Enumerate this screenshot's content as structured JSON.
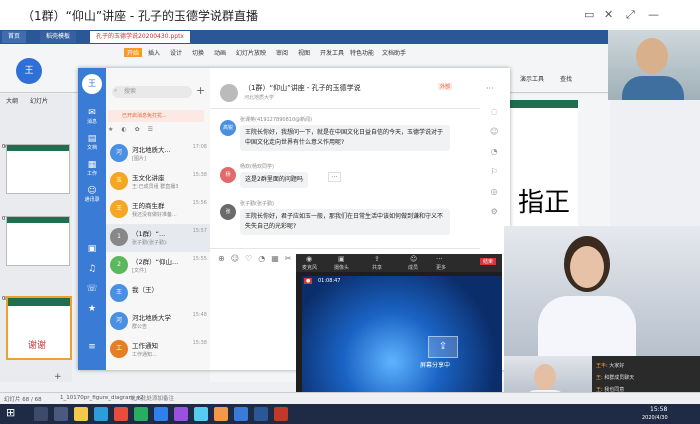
{
  "window": {
    "title": "（1群）“仰山”讲座 - 孔子的玉德学说群直播",
    "controls": [
      "▭",
      "✕",
      "⤢",
      "—"
    ]
  },
  "wps": {
    "tabs": [
      "首页",
      "稻壳模板",
      "孔子的玉德学说20200430.pptx"
    ],
    "ribbon_tabs": [
      "开始",
      "插入",
      "设计",
      "切换",
      "动画",
      "幻灯片放映",
      "审阅",
      "视图",
      "开发工具",
      "特色功能",
      "文档助手"
    ],
    "ribbon_right": [
      "演示工具",
      "查找"
    ],
    "panel_tabs": [
      "大纲",
      "幻灯片"
    ],
    "slide_numbers": [
      "06",
      "07",
      "08"
    ],
    "slide_big_text": "指正",
    "slide_bottom_text": "谢谢",
    "note_placeholder": "单击此处添加备注",
    "status": [
      "幻灯片 68 / 68",
      "1_10170pr_figure_diagram_v2"
    ],
    "add_icon": "plus-icon"
  },
  "chat": {
    "search_placeholder": "搜索",
    "side_items": [
      "消息",
      "文档",
      "工作",
      "通讯录"
    ],
    "filter_banner": "已开启消息免打扰...",
    "conversations": [
      {
        "name": "河北地质大...",
        "msg": "[图片]",
        "time": "17:08",
        "avatar": "河"
      },
      {
        "name": "玉文化讲座",
        "msg": "王:已成员组 群直播3",
        "time": "15:38",
        "avatar": "玉"
      },
      {
        "name": "王的商生群",
        "msg": "我还没有做好准备...",
        "time": "15:56",
        "avatar": "王"
      },
      {
        "name": "（1群）“...",
        "msg": "张子勤(张子勤):",
        "time": "15:57",
        "avatar": "1"
      },
      {
        "name": "（2群）“仰山...",
        "msg": "[文件]",
        "time": "15:55",
        "avatar": "2"
      },
      {
        "name": "我（王）",
        "msg": "",
        "time": "",
        "avatar": "王"
      },
      {
        "name": "河北地质大学",
        "msg": "群公告",
        "time": "15:48",
        "avatar": "河"
      },
      {
        "name": "工作通知",
        "msg": "工作通知...",
        "time": "15:38",
        "avatar": "工"
      }
    ],
    "header": {
      "title": "（1群）“仰山”讲座 - 孔子的玉德学说",
      "subtitle": "河北地质大学",
      "badge": "外部"
    },
    "messages": [
      {
        "name": "张课英(419127890810@新闻)",
        "text": "王院长你好，我想问一下，就是在中国文化日益自信的今天，玉德学说对于中国文化走向世界有什么意义作用呢?",
        "avatar": "高锐"
      },
      {
        "name": "杨欢(杨欢同学)",
        "text": "这是2群里面的问题吗",
        "avatar": "杨"
      },
      {
        "name": "张子勤(张子勤)",
        "text": "王院长你好，君子应如玉一般，那我们在日常生活中该如何做到谦和守义不失失自己的光彩呢?",
        "avatar": "张"
      }
    ],
    "more_icon": "ellipsis-icon"
  },
  "share": {
    "label": "屏幕分享中",
    "timer": "01:08:47",
    "toolbar": [
      "麦克风",
      "摄像头",
      "共享",
      "成员",
      "更多",
      "结束"
    ]
  },
  "taskbar": {
    "time": "15:58",
    "date": "2020/4/30"
  },
  "cam_chat": [
    {
      "name": "王丰",
      "msg": "大家好"
    },
    {
      "name": "王",
      "msg": "和群成员聊天"
    },
    {
      "name": "王",
      "msg": "我也同意"
    }
  ],
  "colors": {
    "wps_blue": "#2b5797",
    "chat_blue": "#3a7bd5",
    "taskbar": "#1f2a44"
  }
}
